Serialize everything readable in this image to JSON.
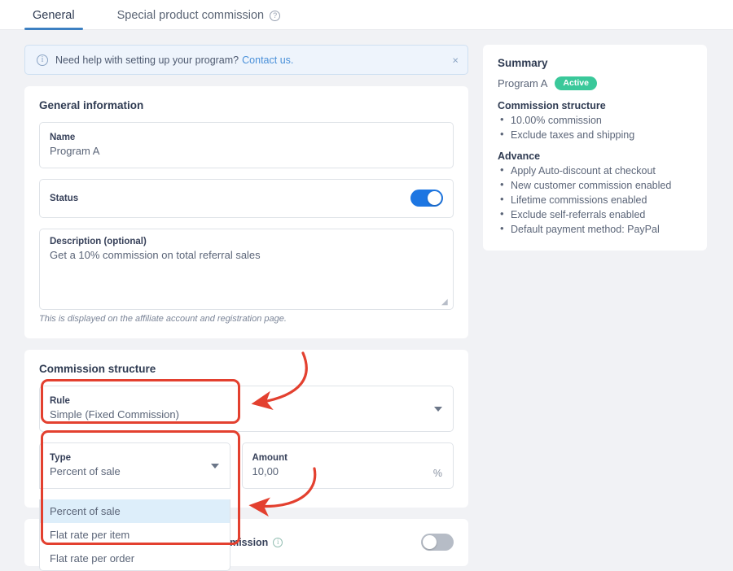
{
  "tabs": [
    {
      "label": "General",
      "active": true,
      "icon": null
    },
    {
      "label": "Special product commission",
      "active": false,
      "icon": "help-circle-icon"
    }
  ],
  "banner": {
    "icon": "info-circle-icon",
    "text": "Need help with setting up your program?",
    "link_label": "Contact us.",
    "close_label": "×"
  },
  "general_information": {
    "title": "General information",
    "name": {
      "label": "Name",
      "value": "Program A"
    },
    "status": {
      "label": "Status",
      "toggle_on": true
    },
    "description": {
      "label": "Description (optional)",
      "value": "Get a 10% commission on total referral sales",
      "helper": "This is displayed on the affiliate account and registration page."
    }
  },
  "commission_structure": {
    "title": "Commission structure",
    "rule": {
      "label": "Rule",
      "value": "Simple (Fixed Commission)"
    },
    "type": {
      "label": "Type",
      "value": "Percent of sale",
      "options": [
        {
          "label": "Percent of sale",
          "selected": true
        },
        {
          "label": "Flat rate per item",
          "selected": false
        },
        {
          "label": "Flat rate per order",
          "selected": false
        }
      ]
    },
    "amount": {
      "label": "Amount",
      "value": "10,00",
      "suffix": "%"
    },
    "exclude": {
      "label": "Exclude products/collections from commission",
      "icon": "info-circle-icon",
      "toggle_on": false
    }
  },
  "summary": {
    "title": "Summary",
    "program_name": "Program A",
    "status_badge": "Active",
    "sections": [
      {
        "heading": "Commission structure",
        "items": [
          "10.00% commission",
          "Exclude taxes and shipping"
        ]
      },
      {
        "heading": "Advance",
        "items": [
          "Apply Auto-discount at checkout",
          "New customer commission enabled",
          "Lifetime commissions enabled",
          "Exclude self-referrals enabled",
          "Default payment method: PayPal"
        ]
      }
    ]
  },
  "annotations": {
    "color": "#e3402f",
    "boxes": [
      {
        "name": "rule-highlight"
      },
      {
        "name": "type-highlight"
      }
    ],
    "arrows": [
      {
        "name": "arrow-to-rule"
      },
      {
        "name": "arrow-to-type-options"
      }
    ]
  },
  "colors": {
    "accent_blue": "#1d76e2",
    "tab_underline": "#3d80c2",
    "badge_green": "#3ac89a",
    "annotation_red": "#e3402f",
    "page_bg": "#f1f2f5"
  }
}
